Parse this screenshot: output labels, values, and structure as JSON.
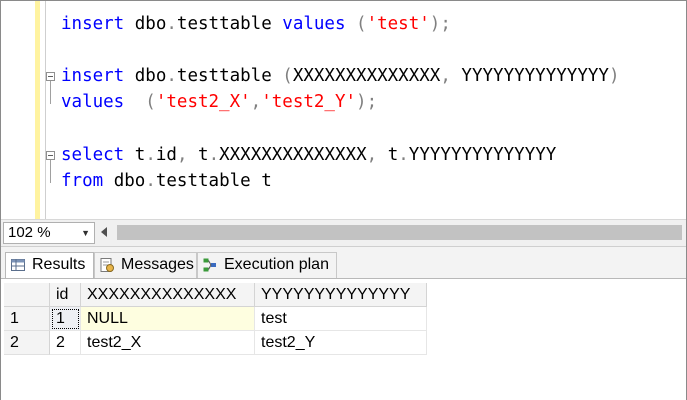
{
  "editor": {
    "lines": [
      {
        "parts": [
          [
            "kw",
            "insert"
          ],
          [
            "",
            "dbo"
          ],
          [
            "gray",
            "."
          ],
          [
            "",
            "testtable "
          ],
          [
            "kw",
            "values"
          ],
          [
            "gray",
            " ("
          ],
          [
            "str",
            "'test'"
          ],
          [
            "gray",
            ");"
          ]
        ]
      },
      {
        "parts": [
          [
            "kw",
            "insert"
          ],
          [
            "",
            "dbo"
          ],
          [
            "gray",
            "."
          ],
          [
            "",
            "testtable "
          ],
          [
            "gray",
            "("
          ],
          [
            "",
            "XXXXXXXXXXXXXX"
          ],
          [
            "gray",
            ", "
          ],
          [
            "",
            "YYYYYYYYYYYYYY"
          ],
          [
            "gray",
            ")"
          ]
        ]
      },
      {
        "parts": [
          [
            "kw",
            "values"
          ],
          [
            "gray",
            " ("
          ],
          [
            "str",
            "'test2_X'"
          ],
          [
            "gray",
            ","
          ],
          [
            "str",
            "'test2_Y'"
          ],
          [
            "gray",
            ");"
          ]
        ]
      },
      {
        "parts": [
          [
            "kw",
            "select"
          ],
          [
            "",
            "t"
          ],
          [
            "gray",
            "."
          ],
          [
            "",
            "id"
          ],
          [
            "gray",
            ", "
          ],
          [
            "",
            "t"
          ],
          [
            "gray",
            "."
          ],
          [
            "",
            "XXXXXXXXXXXXXX"
          ],
          [
            "gray",
            ", "
          ],
          [
            "",
            "t"
          ],
          [
            "gray",
            "."
          ],
          [
            "",
            "YYYYYYYYYYYYYY"
          ]
        ]
      },
      {
        "parts": [
          [
            "kw",
            "from"
          ],
          [
            "",
            "dbo"
          ],
          [
            "gray",
            "."
          ],
          [
            "",
            "testtable t"
          ]
        ]
      }
    ]
  },
  "zoom": {
    "value": "102 %"
  },
  "tabs": [
    {
      "label": "Results",
      "icon": "grid-icon",
      "active": true
    },
    {
      "label": "Messages",
      "icon": "messages-icon",
      "active": false
    },
    {
      "label": "Execution plan",
      "icon": "execution-plan-icon",
      "active": false
    }
  ],
  "grid": {
    "columns": [
      "id",
      "XXXXXXXXXXXXXX",
      "YYYYYYYYYYYYYY"
    ],
    "rows": [
      {
        "num": "1",
        "cells": [
          "1",
          "NULL",
          "test"
        ]
      },
      {
        "num": "2",
        "cells": [
          "2",
          "test2_X",
          "test2_Y"
        ]
      }
    ]
  }
}
